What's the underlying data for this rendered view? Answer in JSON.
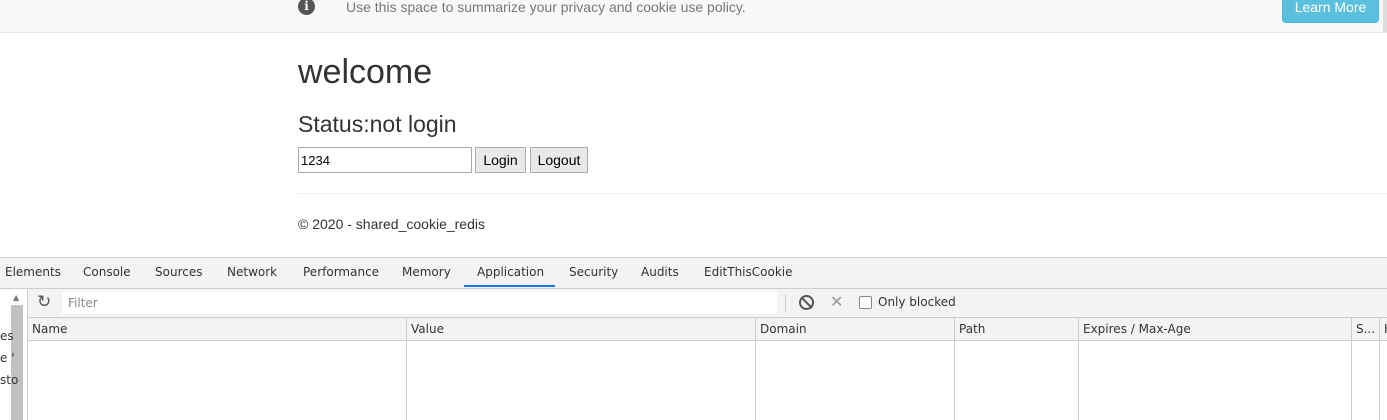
{
  "banner": {
    "icon": "info-icon",
    "message": "Use this space to summarize your privacy and cookie use policy.",
    "learn_more": "Learn More"
  },
  "main": {
    "heading": "welcome",
    "status_label": "Status:",
    "status_value": "not login",
    "input_value": "1234",
    "login_label": "Login",
    "logout_label": "Logout",
    "footer": "© 2020 - shared_cookie_redis"
  },
  "devtools": {
    "tabs": [
      "Elements",
      "Console",
      "Sources",
      "Network",
      "Performance",
      "Memory",
      "Application",
      "Security",
      "Audits",
      "EditThisCookie"
    ],
    "active_tab": "Application",
    "accent": "#1a73e8",
    "left_fragments": [
      "es",
      "e '",
      "sto"
    ],
    "filter_placeholder": "Filter",
    "only_blocked_label": "Only blocked",
    "only_blocked_checked": false,
    "columns": [
      "Name",
      "Value",
      "Domain",
      "Path",
      "Expires / Max-Age",
      "S...",
      "H"
    ]
  },
  "colors": {
    "learn_more_bg": "#5bc0de",
    "banner_bg": "#f8f8f8"
  }
}
